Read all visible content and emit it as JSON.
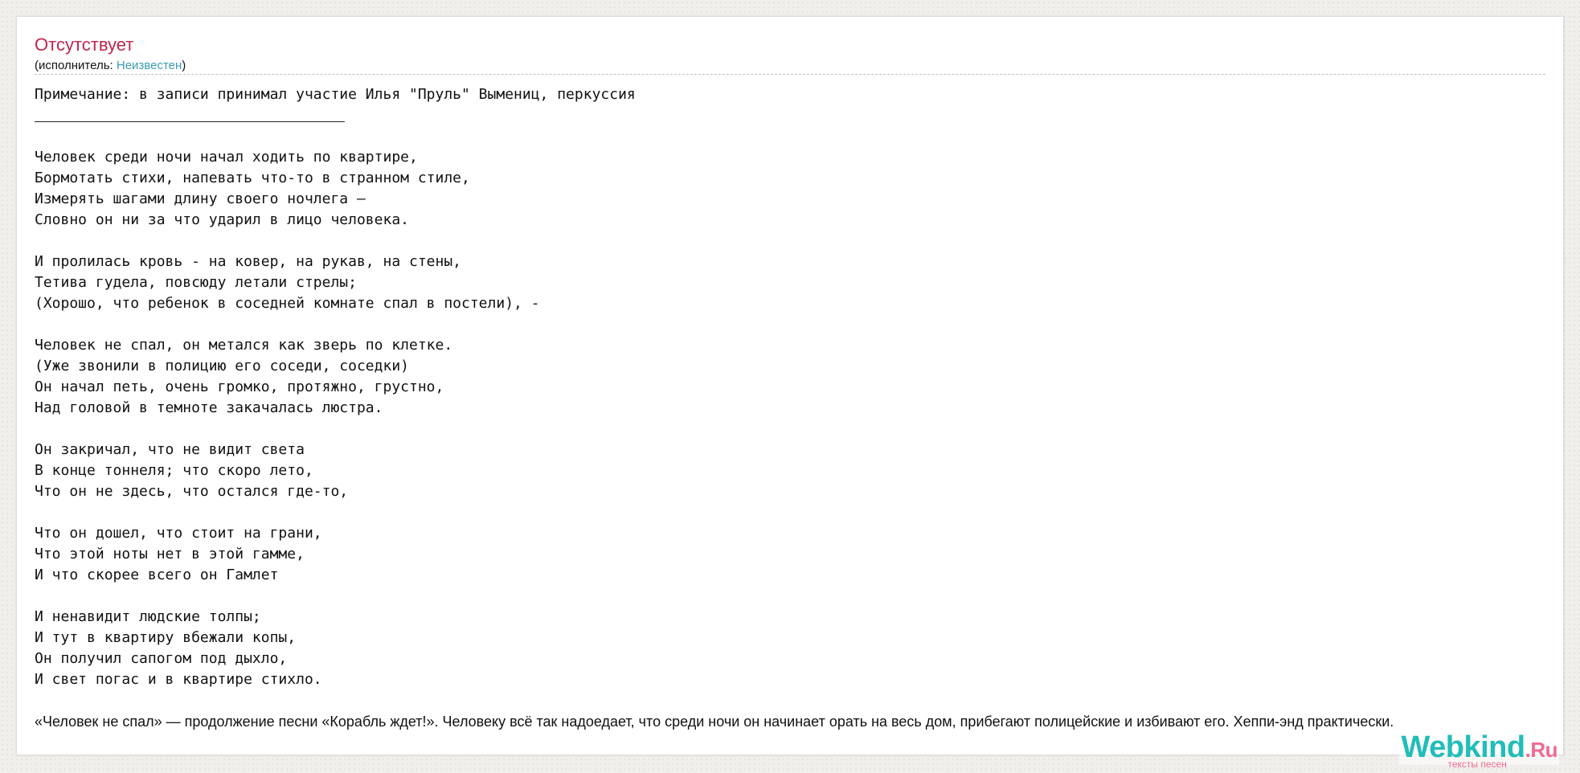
{
  "song": {
    "title": "Отсутствует",
    "performer_prefix": "(исполнитель: ",
    "performer_name": "Неизвестен",
    "performer_suffix": ")"
  },
  "lyrics": "Примечание: в записи принимал участие Илья \"Пруль\" Вымениц, перкуссия\n\n\nЧеловек среди ночи начал ходить по квартире,\nБормотать стихи, напевать что-то в странном стиле,\nИзмерять шагами длину своего ночлега –\nСловно он ни за что ударил в лицо человека.\n\nИ пролилась кровь - на ковер, на рукав, на стены,\nТетива гудела, повсюду летали стрелы;\n(Хорошо, что ребенок в соседней комнате спал в постели), -\n\nЧеловек не спал, он метался как зверь по клетке.\n(Уже звонили в полицию его соседи, соседки)\nОн начал петь, очень громко, протяжно, грустно,\nНад головой в темноте закачалась люстра.\n\nОн закричал, что не видит света\nВ конце тоннеля; что скоро лето,\nЧто он не здесь, что остался где-то,\n\nЧто он дошел, что стоит на грани,\nЧто этой ноты нет в этой гамме,\nИ что скорее всего он Гамлет\n\nИ ненавидит людские толпы;\nИ тут в квартиру вбежали копы,\nОн получил сапогом под дыхло,\nИ свет погас и в квартире стихло.",
  "description": "«Человек не спал» — продолжение песни «Корабль ждет!». Человеку всё так надоедает, что среди ночи он начинает орать на весь дом, прибегают полицейские и избивают его. Хеппи-энд практически.",
  "logo": {
    "main": "Webkind",
    "domain": ".Ru",
    "tagline": "тексты песен"
  }
}
